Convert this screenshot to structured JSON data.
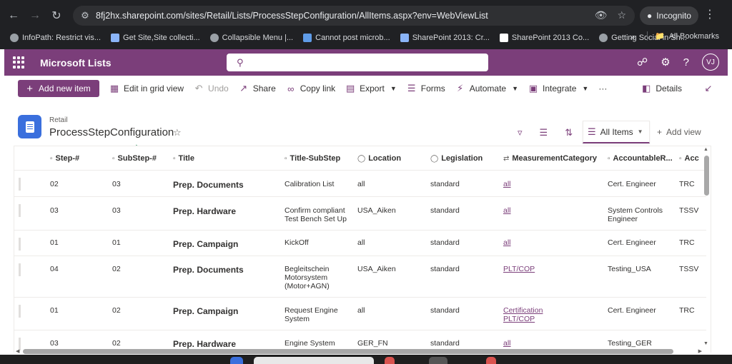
{
  "browser": {
    "url": "8fj2hx.sharepoint.com/sites/Retail/Lists/ProcessStepConfiguration/AllItems.aspx?env=WebViewList",
    "incognito_label": "Incognito",
    "bookmarks": [
      {
        "label": "InfoPath: Restrict vis...",
        "icon": "globe-icon"
      },
      {
        "label": "Get Site,Site collecti...",
        "icon": "grid-icon"
      },
      {
        "label": "Collapsible Menu |...",
        "icon": "globe-icon"
      },
      {
        "label": "Cannot post microb...",
        "icon": "puzzle-icon"
      },
      {
        "label": "SharePoint 2013: Cr...",
        "icon": "grid-icon"
      },
      {
        "label": "SharePoint 2013 Co...",
        "icon": "sharepoint-icon"
      },
      {
        "label": "Getting Social in Sh...",
        "icon": "globe-icon"
      }
    ],
    "all_bookmarks_label": "All Bookmarks"
  },
  "suite": {
    "app_name": "Microsoft Lists",
    "search_placeholder": "",
    "avatar_initials": "VJ"
  },
  "commands": {
    "new_item": "Add new item",
    "edit_grid": "Edit in grid view",
    "undo": "Undo",
    "share": "Share",
    "copy_link": "Copy link",
    "export": "Export",
    "forms": "Forms",
    "automate": "Automate",
    "integrate": "Integrate",
    "more": "···",
    "details": "Details"
  },
  "list": {
    "site": "Retail",
    "title": "ProcessStepConfiguration",
    "view_name": "All Items",
    "add_view": "Add view"
  },
  "columns": [
    "Step-#",
    "SubStep-#",
    "Title",
    "Title-SubStep",
    "Location",
    "Legislation",
    "MeasurementCategory",
    "AccountableR...",
    "Acc"
  ],
  "rows": [
    {
      "step": "02",
      "substep": "03",
      "title": "Prep. Documents",
      "subtitle": [
        "Calibration List"
      ],
      "location": "all",
      "legislation": "standard",
      "measurement": [
        "all"
      ],
      "accountable": [
        "Cert. Engineer"
      ],
      "acc": "TRC"
    },
    {
      "step": "03",
      "substep": "03",
      "title": "Prep. Hardware",
      "subtitle": [
        "Confirm compliant",
        "Test Bench Set Up"
      ],
      "location": "USA_Aiken",
      "legislation": "standard",
      "measurement": [
        "all"
      ],
      "accountable": [
        "System Controls",
        "Engineer"
      ],
      "acc": "TSSV"
    },
    {
      "step": "01",
      "substep": "01",
      "title": "Prep. Campaign",
      "subtitle": [
        "KickOff"
      ],
      "location": "all",
      "legislation": "standard",
      "measurement": [
        "all"
      ],
      "accountable": [
        "Cert. Engineer"
      ],
      "acc": "TRC"
    },
    {
      "step": "04",
      "substep": "02",
      "title": "Prep. Documents",
      "subtitle": [
        "Begleitschein",
        "Motorsystem",
        "(Motor+AGN)"
      ],
      "location": "USA_Aiken",
      "legislation": "standard",
      "measurement": [
        "PLT/COP"
      ],
      "accountable": [
        "Testing_USA"
      ],
      "acc": "TSSV"
    },
    {
      "step": "01",
      "substep": "02",
      "title": "Prep. Campaign",
      "subtitle": [
        "Request Engine",
        "System"
      ],
      "location": "all",
      "legislation": "standard",
      "measurement": [
        "Certification",
        "PLT/COP"
      ],
      "accountable": [
        "Cert. Engineer"
      ],
      "acc": "TRC"
    },
    {
      "step": "03",
      "substep": "02",
      "title": "Prep. Hardware",
      "subtitle": [
        "Engine System"
      ],
      "location": "GER_FN",
      "legislation": "standard",
      "measurement": [
        "all"
      ],
      "accountable": [
        "Testing_GER"
      ],
      "acc": ""
    }
  ],
  "colors": {
    "brand": "#7b3e7a",
    "list_icon": "#3a6fdd"
  }
}
